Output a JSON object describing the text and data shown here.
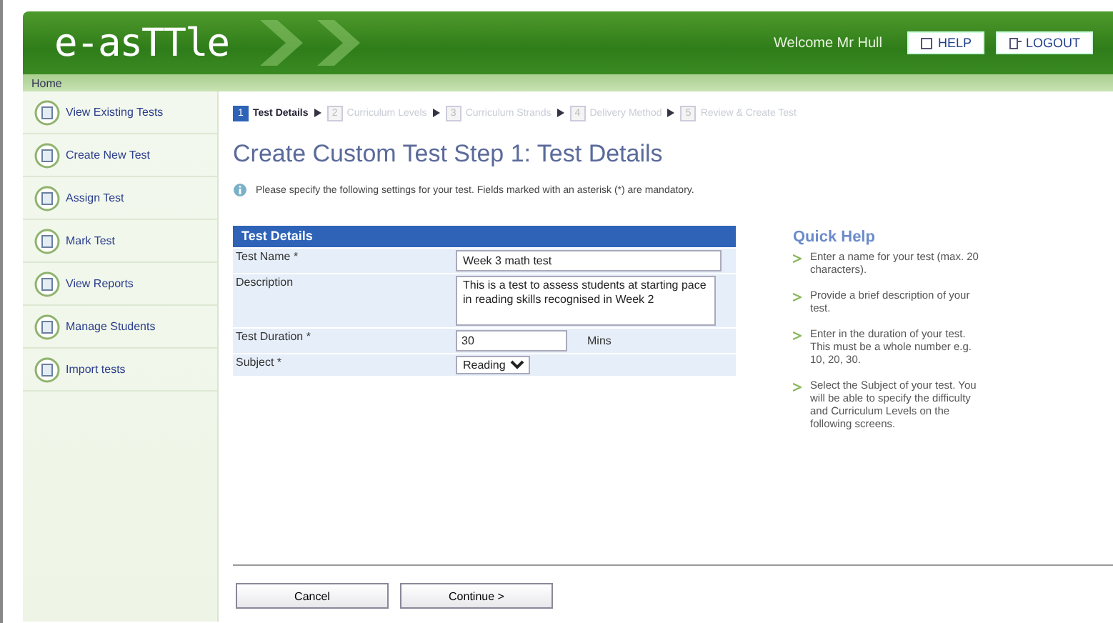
{
  "header": {
    "logo": "e-asTTle",
    "welcome": "Welcome Mr Hull",
    "buttons": [
      {
        "label": "HELP",
        "kind": "help"
      },
      {
        "label": "LOGOUT",
        "kind": "logout"
      }
    ]
  },
  "breadcrumb": "Home",
  "sidebar": {
    "items": [
      {
        "label": "View Existing Tests"
      },
      {
        "label": "Create New Test"
      },
      {
        "label": "Assign Test"
      },
      {
        "label": "Mark Test"
      },
      {
        "label": "View Reports"
      },
      {
        "label": "Manage Students"
      },
      {
        "label": "Import tests"
      }
    ]
  },
  "steps": [
    {
      "number": "1",
      "label": "Test Details",
      "selected": true
    },
    {
      "number": "2",
      "label": "Curriculum Levels",
      "selected": false
    },
    {
      "number": "3",
      "label": "Curriculum Strands",
      "selected": false
    },
    {
      "number": "4",
      "label": "Delivery Method",
      "selected": false
    },
    {
      "number": "5",
      "label": "Review & Create Test",
      "selected": false
    }
  ],
  "title": "Create Custom Test Step 1: Test Details",
  "info": "Please specify the following settings for your test. Fields marked with an asterisk (*) are mandatory.",
  "form": {
    "heading": "Test Details",
    "fields": [
      {
        "kind": "text",
        "label": "Test Name *",
        "value": "Week 3 math test"
      },
      {
        "kind": "textarea",
        "label": "Description",
        "value": "This is a test to assess students at starting pace in reading skills recognised in Week 2"
      },
      {
        "kind": "number",
        "label": "Test Duration *",
        "value": "30",
        "unit": "Mins"
      },
      {
        "kind": "select",
        "label": "Subject *",
        "value": "Reading"
      }
    ]
  },
  "quick_help": {
    "title": "Quick Help",
    "items": [
      "Enter a name for your test (max. 20 characters).",
      "Provide a brief description of your test.",
      "Enter in the duration of your test. This must be a whole number e.g. 10, 20, 30.",
      "Select the Subject of your test. You will be able to specify the difficulty and Curriculum Levels on the following screens."
    ]
  },
  "buttons": [
    {
      "label": "Cancel"
    },
    {
      "label": "Continue >"
    }
  ]
}
